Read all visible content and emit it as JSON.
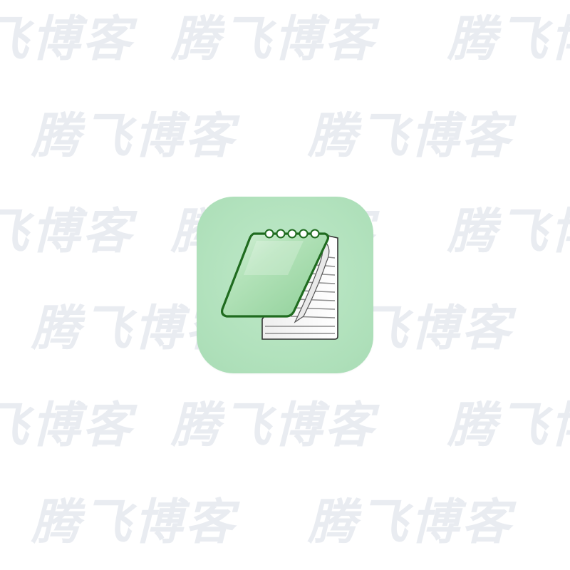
{
  "image": {
    "watermark_text": "腾飞博客",
    "icon_name": "notepad-icon",
    "colors": {
      "background": "#ffffff",
      "watermark": "#e9ecf1",
      "tile": "#b2e2bd",
      "cover_fill": "#9fd8a6",
      "cover_outline": "#1f6b1f",
      "paper": "#fafafa",
      "paper_lines": "#9a9a9a"
    }
  }
}
